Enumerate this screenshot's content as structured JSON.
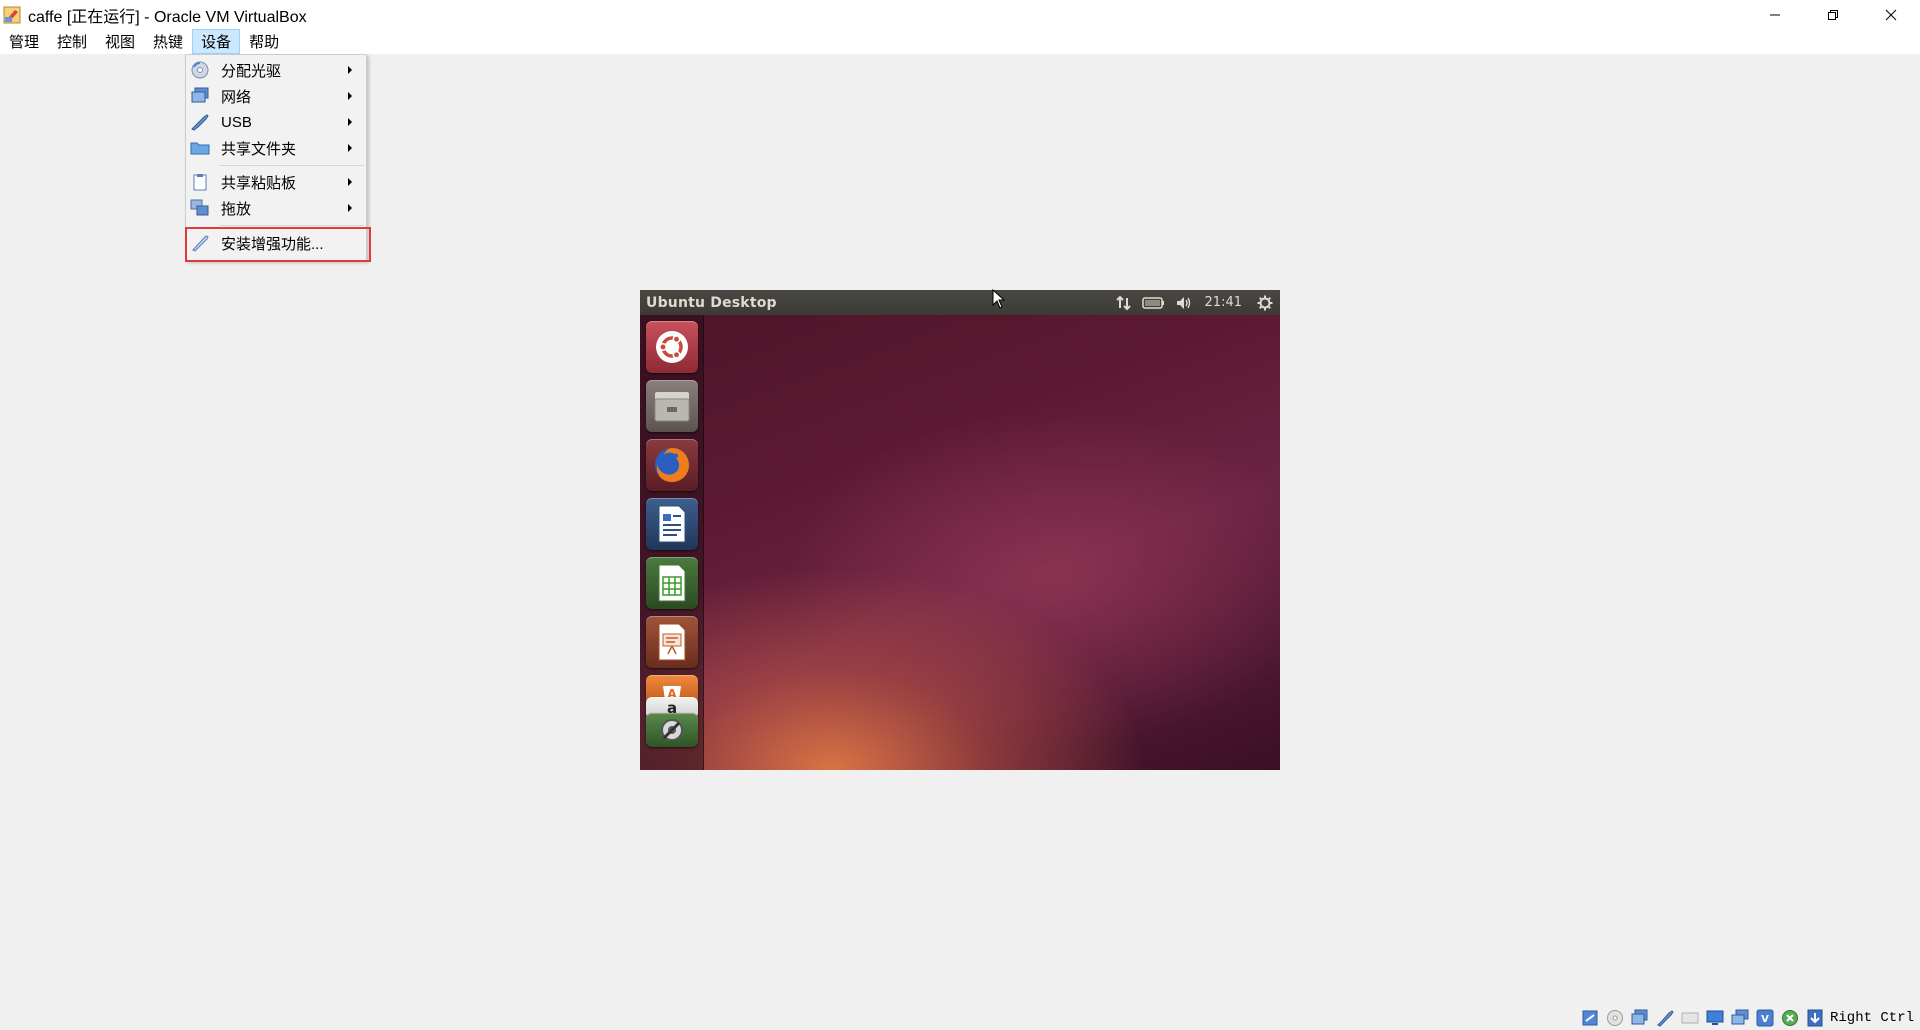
{
  "window": {
    "title": "caffe [正在运行] - Oracle VM VirtualBox"
  },
  "menubar": {
    "items": [
      {
        "label": "管理"
      },
      {
        "label": "控制"
      },
      {
        "label": "视图"
      },
      {
        "label": "热键"
      },
      {
        "label": "设备"
      },
      {
        "label": "帮助"
      }
    ],
    "active_index": 4
  },
  "devices_menu": {
    "items": [
      {
        "label": "分配光驱",
        "icon": "optical-drive-icon",
        "has_submenu": true
      },
      {
        "label": "网络",
        "icon": "network-icon",
        "has_submenu": true
      },
      {
        "label": "USB",
        "icon": "usb-icon",
        "has_submenu": true
      },
      {
        "label": "共享文件夹",
        "icon": "shared-folder-icon",
        "has_submenu": true
      },
      {
        "label": "共享粘贴板",
        "icon": "clipboard-icon",
        "has_submenu": true
      },
      {
        "label": "拖放",
        "icon": "drag-drop-icon",
        "has_submenu": true
      },
      {
        "label": "安装增强功能...",
        "icon": "guest-additions-icon",
        "has_submenu": false
      }
    ],
    "highlighted_item": "安装增强功能..."
  },
  "vm_screen": {
    "panel_title": "Ubuntu Desktop",
    "clock": "21:41",
    "launcher": [
      {
        "name": "ubuntu-dash-icon"
      },
      {
        "name": "files-icon"
      },
      {
        "name": "firefox-icon"
      },
      {
        "name": "libreoffice-writer-icon"
      },
      {
        "name": "libreoffice-calc-icon"
      },
      {
        "name": "libreoffice-impress-icon"
      },
      {
        "name": "software-center-icon"
      },
      {
        "name": "amazon-icon"
      },
      {
        "name": "system-settings-icon"
      }
    ]
  },
  "statusbar": {
    "host_key": "Right Ctrl"
  },
  "colors": {
    "menu_active_bg": "#cce8ff",
    "highlight_box": "#e03a3a",
    "ubuntu_panel": "#3b3a36"
  }
}
